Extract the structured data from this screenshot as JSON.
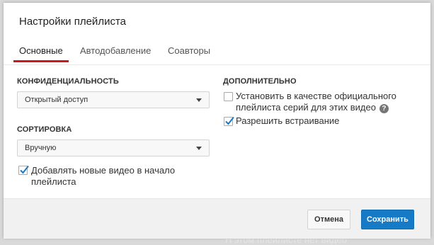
{
  "background": {
    "partial_text": "Н этом плейлисте нет видео"
  },
  "dialog": {
    "title": "Настройки плейлиста",
    "tabs": [
      {
        "label": "Основные",
        "active": true
      },
      {
        "label": "Автодобавление",
        "active": false
      },
      {
        "label": "Соавторы",
        "active": false
      }
    ],
    "privacy": {
      "label": "КОНФИДЕНЦИАЛЬНОСТЬ",
      "selected": "Открытый доступ"
    },
    "sorting": {
      "label": "СОРТИРОВКА",
      "selected": "Вручную"
    },
    "add_to_top": {
      "label": "Добавлять новые видео в начало плейлиста",
      "checked": true
    },
    "additional": {
      "label": "ДОПОЛНИТЕЛЬНО",
      "official_series": {
        "label": "Установить в качестве официального плейлиста серий для этих видео",
        "checked": false,
        "help_icon": "question-circle-icon"
      },
      "allow_embed": {
        "label": "Разрешить встраивание",
        "checked": true
      }
    },
    "buttons": {
      "cancel": "Отмена",
      "save": "Сохранить"
    }
  },
  "colors": {
    "accent": "#cc181e",
    "primary_button": "#167ac6",
    "check": "#167ac6"
  }
}
